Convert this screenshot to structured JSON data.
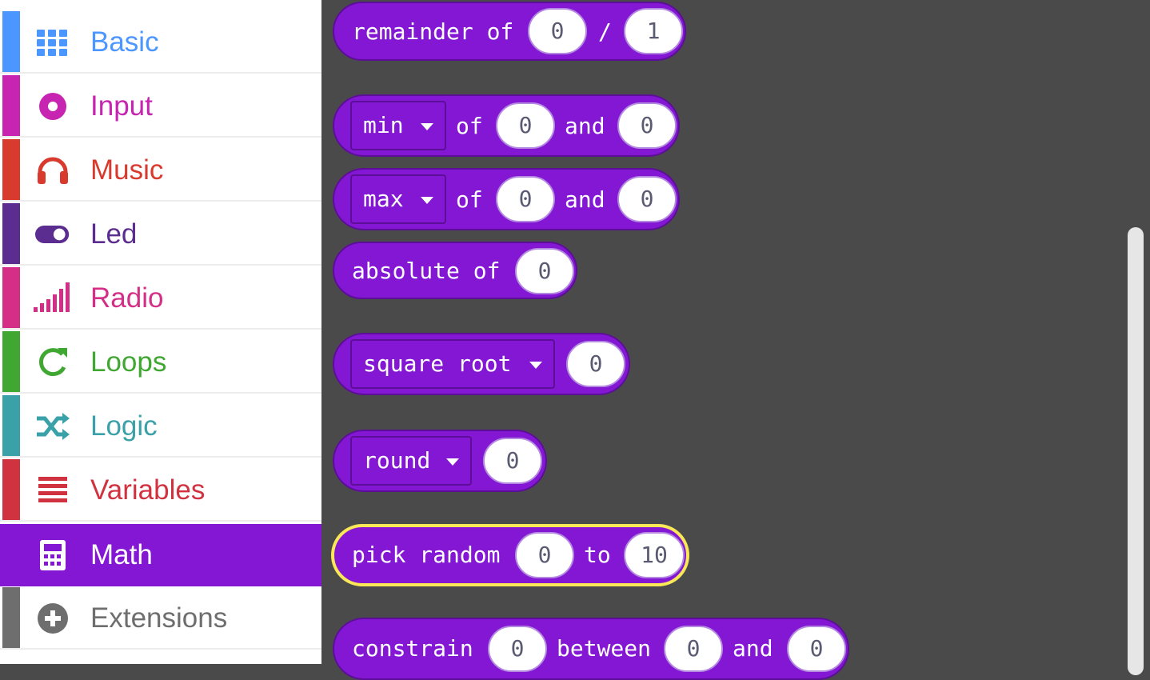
{
  "toolbox": {
    "categories": [
      {
        "label": "Basic",
        "color": "#4c97ff",
        "icon": "grid-icon"
      },
      {
        "label": "Input",
        "color": "#c724b1",
        "icon": "target-icon"
      },
      {
        "label": "Music",
        "color": "#d83b2d",
        "icon": "headphones-icon"
      },
      {
        "label": "Led",
        "color": "#5c2d91",
        "icon": "toggle-icon"
      },
      {
        "label": "Radio",
        "color": "#d42e86",
        "icon": "signal-bars-icon"
      },
      {
        "label": "Loops",
        "color": "#40a832",
        "icon": "loop-arrow-icon"
      },
      {
        "label": "Logic",
        "color": "#3aa1a8",
        "icon": "shuffle-icon"
      },
      {
        "label": "Variables",
        "color": "#d13240",
        "icon": "lines-icon"
      },
      {
        "label": "Math",
        "color": "#8417d4",
        "icon": "calculator-icon",
        "selected": true
      },
      {
        "label": "Extensions",
        "color": "#6e6e6e",
        "icon": "plus-circle-icon"
      }
    ]
  },
  "flyout": {
    "remainder": {
      "label": "remainder of",
      "sep": "/",
      "a": "0",
      "b": "1"
    },
    "min": {
      "op": "min",
      "of": "of",
      "a": "0",
      "and": "and",
      "b": "0"
    },
    "max": {
      "op": "max",
      "of": "of",
      "a": "0",
      "and": "and",
      "b": "0"
    },
    "absolute": {
      "label": "absolute of",
      "a": "0"
    },
    "sqrt": {
      "op": "square root",
      "a": "0"
    },
    "round": {
      "op": "round",
      "a": "0"
    },
    "random": {
      "label": "pick random",
      "a": "0",
      "to": "to",
      "b": "10"
    },
    "constrain": {
      "label": "constrain",
      "a": "0",
      "between": "between",
      "b": "0",
      "and": "and",
      "c": "0"
    }
  },
  "colors": {
    "math": "#8417d4",
    "highlight": "#fae857",
    "workspace": "#4a4a4a"
  }
}
